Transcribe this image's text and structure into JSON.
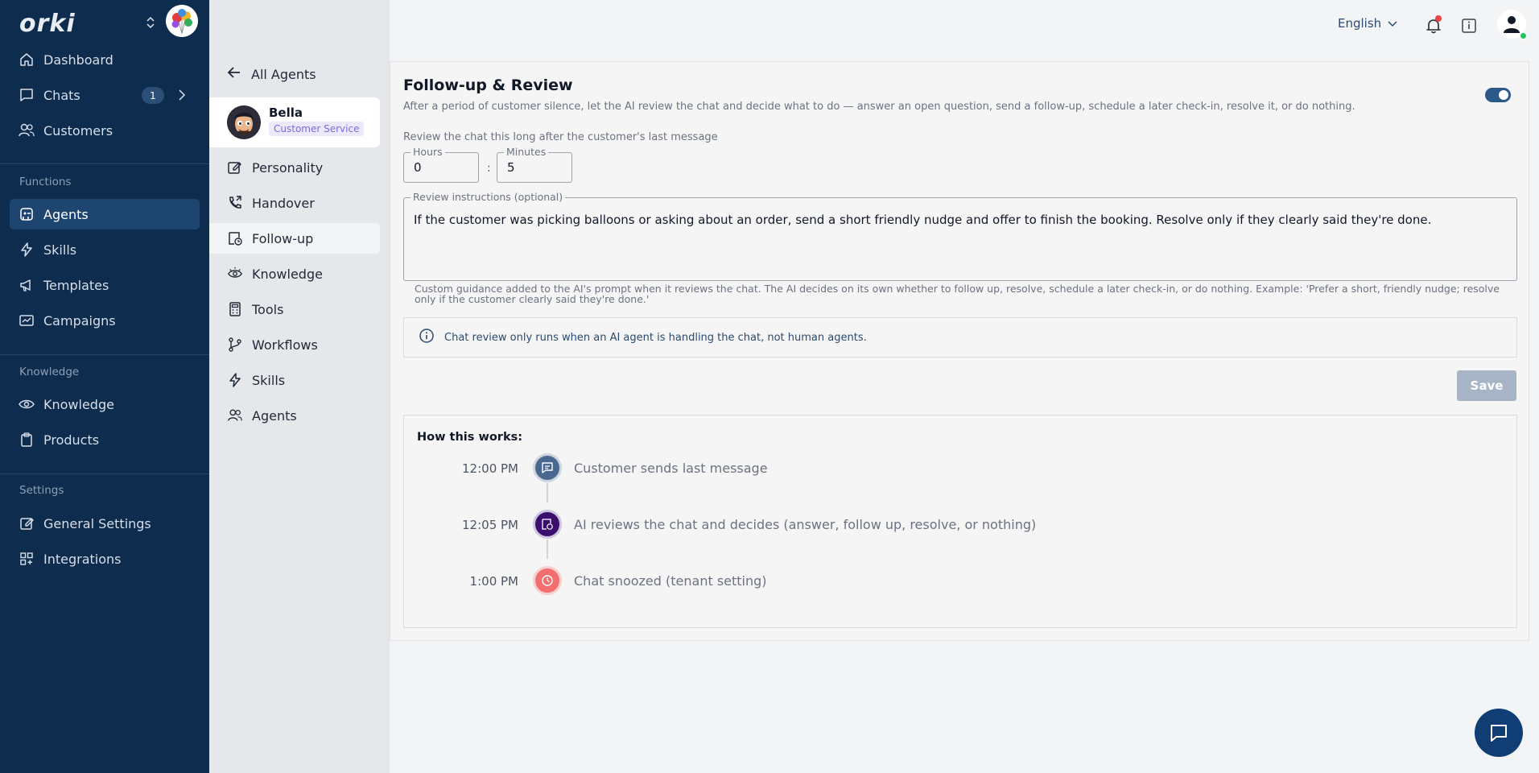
{
  "brand": {
    "name": "orki"
  },
  "sidebar": {
    "items": [
      {
        "label": "Dashboard",
        "icon": "home-icon"
      },
      {
        "label": "Chats",
        "icon": "chat-bubble-icon",
        "badge": "1"
      },
      {
        "label": "Customers",
        "icon": "users-icon"
      },
      {
        "label": "Agents",
        "icon": "agent-icon"
      },
      {
        "label": "Skills",
        "icon": "lightning-icon"
      },
      {
        "label": "Templates",
        "icon": "megaphone-icon"
      },
      {
        "label": "Campaigns",
        "icon": "campaign-icon"
      },
      {
        "label": "Knowledge",
        "icon": "eye-icon"
      },
      {
        "label": "Products",
        "icon": "clipboard-icon"
      },
      {
        "label": "General Settings",
        "icon": "edit-icon"
      },
      {
        "label": "Integrations",
        "icon": "grid-icon"
      }
    ],
    "sections": {
      "functions": "Functions",
      "knowledge": "Knowledge",
      "settings": "Settings"
    },
    "active": "Agents"
  },
  "subnav": {
    "back_label": "All Agents",
    "agent": {
      "name": "Bella",
      "role": "Customer Service"
    },
    "items": [
      {
        "label": "Personality",
        "icon": "edit-icon"
      },
      {
        "label": "Handover",
        "icon": "phone-transfer-icon"
      },
      {
        "label": "Follow-up",
        "icon": "follow-up-icon"
      },
      {
        "label": "Knowledge",
        "icon": "eye-icon"
      },
      {
        "label": "Tools",
        "icon": "calculator-icon"
      },
      {
        "label": "Workflows",
        "icon": "workflow-icon"
      },
      {
        "label": "Skills",
        "icon": "lightning-icon"
      },
      {
        "label": "Agents",
        "icon": "users-icon"
      }
    ],
    "active": "Follow-up"
  },
  "header": {
    "language": "English"
  },
  "main": {
    "title": "Follow-up & Review",
    "description": "After a period of customer silence, let the AI review the chat and decide what to do — answer an open question, send a follow-up, schedule a later check-in, resolve it, or do nothing.",
    "enabled": true,
    "review_label": "Review the chat this long after the customer's last message",
    "hours": {
      "label": "Hours",
      "value": "0"
    },
    "minutes": {
      "label": "Minutes",
      "value": "5"
    },
    "instructions": {
      "label": "Review instructions (optional)",
      "value": "If the customer was picking balloons or asking about an order, send a short friendly nudge and offer to finish the booking. Resolve only if they clearly said they're done."
    },
    "help_text": "Custom guidance added to the AI's prompt when it reviews the chat. The AI decides on its own whether to follow up, resolve, schedule a later check-in, or do nothing. Example: 'Prefer a short, friendly nudge; resolve only if the customer clearly said they're done.'",
    "info_note": "Chat review only runs when an AI agent is handling the chat, not human agents.",
    "save_label": "Save",
    "how": {
      "title": "How this works:",
      "steps": [
        {
          "time": "12:00 PM",
          "text": "Customer sends last message",
          "color": "#4a6790"
        },
        {
          "time": "12:05 PM",
          "text": "AI reviews the chat and decides (answer, follow up, resolve, or nothing)",
          "color": "#3b0f6e"
        },
        {
          "time": "1:00 PM",
          "text": "Chat snoozed (tenant setting)",
          "color": "#f36f6f"
        }
      ]
    }
  }
}
